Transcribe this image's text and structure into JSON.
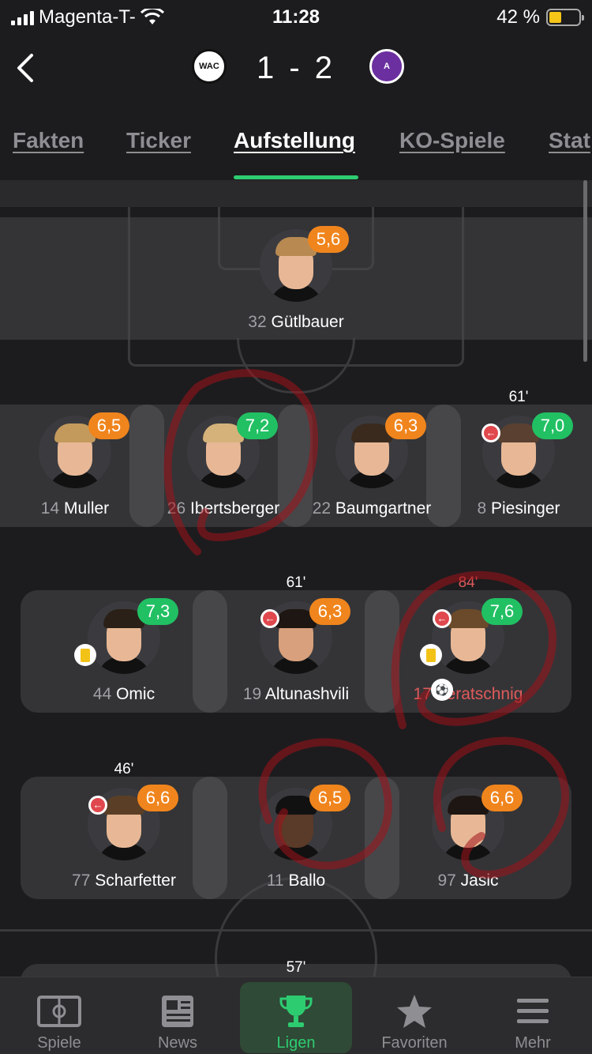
{
  "status_bar": {
    "carrier": "Magenta-T-",
    "time": "11:28",
    "battery": "42 %",
    "battery_level": 0.42
  },
  "header": {
    "score": "1 - 2",
    "home_crest_text": "WAC",
    "away_crest_text": "A"
  },
  "tabs": [
    {
      "label": "Fakten"
    },
    {
      "label": "Ticker"
    },
    {
      "label": "Aufstellung",
      "active": true
    },
    {
      "label": "KO-Spiele"
    },
    {
      "label": "Stat"
    }
  ],
  "lineup": {
    "goalkeeper": {
      "number": "32",
      "name": "Gütlbauer",
      "rating": "5,6",
      "rating_color": "orange"
    },
    "defenders": [
      {
        "number": "14",
        "name": "Muller",
        "rating": "6,5",
        "rating_color": "orange"
      },
      {
        "number": "26",
        "name": "Ibertsberger",
        "rating": "7,2",
        "rating_color": "green"
      },
      {
        "number": "22",
        "name": "Baumgartner",
        "rating": "6,3",
        "rating_color": "orange"
      },
      {
        "number": "8",
        "name": "Piesinger",
        "rating": "7,0",
        "rating_color": "green",
        "sub_minute": "61'"
      }
    ],
    "midfield": [
      {
        "number": "44",
        "name": "Omic",
        "rating": "7,3",
        "rating_color": "green",
        "yellow_card": true
      },
      {
        "number": "19",
        "name": "Altunashvili",
        "rating": "6,3",
        "rating_color": "orange",
        "sub_minute": "61'"
      },
      {
        "number": "17",
        "name": "Veratschnig",
        "rating": "7,6",
        "rating_color": "green",
        "sub_minute": "84'",
        "yellow_card": true,
        "goal": true
      }
    ],
    "attack": [
      {
        "number": "77",
        "name": "Scharfetter",
        "rating": "6,6",
        "rating_color": "orange",
        "sub_minute": "46'"
      },
      {
        "number": "11",
        "name": "Ballo",
        "rating": "6,5",
        "rating_color": "orange"
      },
      {
        "number": "97",
        "name": "Jasic",
        "rating": "6,6",
        "rating_color": "orange"
      }
    ],
    "next_row_minute": "57'"
  },
  "bottom_nav": [
    {
      "label": "Spiele",
      "icon": "pitch-icon"
    },
    {
      "label": "News",
      "icon": "newspaper-icon"
    },
    {
      "label": "Ligen",
      "icon": "trophy-icon",
      "active": true
    },
    {
      "label": "Favoriten",
      "icon": "star-icon"
    },
    {
      "label": "Mehr",
      "icon": "menu-icon"
    }
  ],
  "colors": {
    "background": "#1c1c1e",
    "accent_green": "#2ecc71",
    "rating_orange": "#f0851d",
    "rating_green": "#21c063",
    "highlight_red": "#e05a5a"
  }
}
